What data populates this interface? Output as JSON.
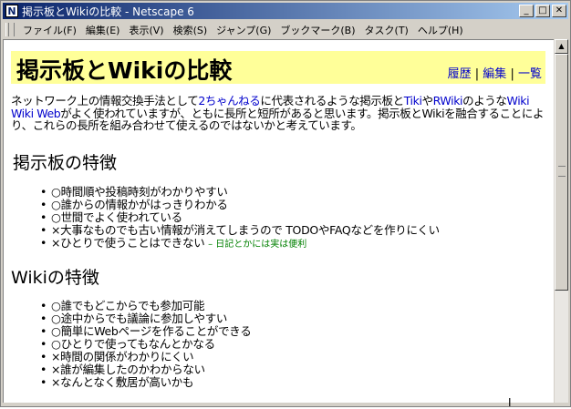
{
  "window": {
    "title": "掲示板とWikiの比較 - Netscape 6",
    "app_icon": "N"
  },
  "menubar": [
    {
      "label": "ファイル(F)"
    },
    {
      "label": "編集(E)"
    },
    {
      "label": "表示(V)"
    },
    {
      "label": "検索(S)"
    },
    {
      "label": "ジャンプ(G)"
    },
    {
      "label": "ブックマーク(B)"
    },
    {
      "label": "タスク(T)"
    },
    {
      "label": "ヘルプ(H)"
    }
  ],
  "page": {
    "title": "掲示板とWikiの比較",
    "header_links": [
      {
        "label": "履歴"
      },
      {
        "label": "編集"
      },
      {
        "label": "一覧"
      }
    ],
    "intro": {
      "t1": "ネットワーク上の情報交換手法として",
      "link1": "2ちゃんねる",
      "t2": "に代表されるような掲示板と",
      "link2": "Tiki",
      "t3": "や",
      "link3": "RWiki",
      "t4": "のような",
      "link4": "Wiki Wiki Web",
      "t5": "がよく使われていますが、ともに長所と短所があると思います。掲示板とWikiを融合することにより、これらの長所を組み合わせて使えるのではないかと考えています。"
    },
    "sections": [
      {
        "title": "掲示板の特徴",
        "items": [
          "○時間順や投稿時刻がわかりやすい",
          "○誰からの情報かがはっきりわかる",
          "○世間でよく使われている",
          "×大事なものでも古い情報が消えてしまうので TODOやFAQなどを作りにくい",
          "×ひとりで使うことはできない"
        ],
        "note": "– 日記とかには実は便利"
      },
      {
        "title": "Wikiの特徴",
        "items": [
          "○誰でもどこからでも参加可能",
          "○途中からでも議論に参加しやすい",
          "○簡単にWebページを作ることができる",
          "○ひとりで使ってもなんとかなる",
          "×時間の関係がわかりにくい",
          "×誰が編集したのかわからない",
          "×なんとなく敷居が高いかも"
        ]
      }
    ]
  }
}
